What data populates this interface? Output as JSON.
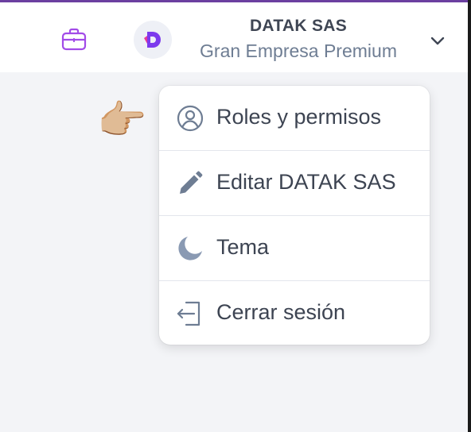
{
  "header": {
    "org_name": "DATAK SAS",
    "org_plan": "Gran Empresa Premium",
    "org_logo_letter": "D",
    "accent_color": "#a24be8",
    "logo_color": "#7c3aed"
  },
  "menu": {
    "items": [
      {
        "label": "Roles y permisos",
        "icon": "user-circle-icon"
      },
      {
        "label": "Editar DATAK SAS",
        "icon": "pencil-icon"
      },
      {
        "label": "Tema",
        "icon": "moon-icon"
      },
      {
        "label": "Cerrar sesión",
        "icon": "logout-icon"
      }
    ]
  },
  "pointer": {
    "glyph": "👉🏼",
    "icon": "pointing-hand-icon"
  }
}
